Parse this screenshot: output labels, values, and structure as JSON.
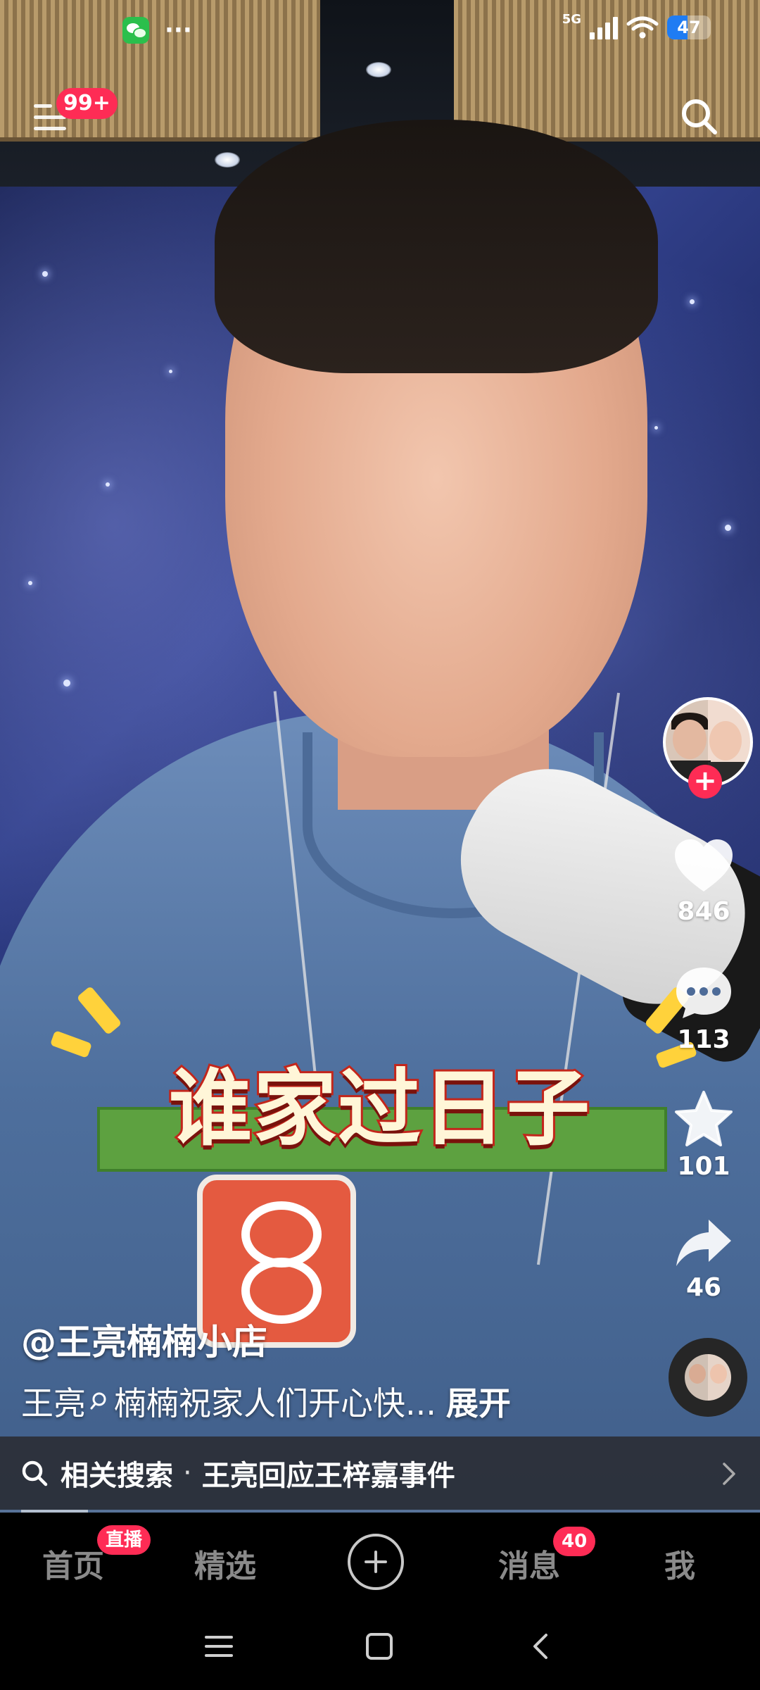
{
  "status_bar": {
    "more": "···",
    "network": "5G",
    "battery": "47",
    "battery_level": 0.47
  },
  "top_bar": {
    "menu_badge": "99+"
  },
  "video": {
    "caption_sticker": "谁家过日子"
  },
  "actions": {
    "follow_symbol": "+",
    "like_count": "846",
    "comment_count": "113",
    "favorite_count": "101",
    "share_count": "46"
  },
  "post": {
    "author": "@王亮楠楠小店",
    "desc_tag": "王亮",
    "desc_text": "楠楠祝家人们开心快...",
    "expand": "展开"
  },
  "related_search": {
    "label": "相关搜索",
    "separator": "·",
    "query": "王亮回应王梓嘉事件"
  },
  "tabs": [
    {
      "label": "首页",
      "badge": "直播"
    },
    {
      "label": "精选"
    },
    {
      "label": "消息",
      "badge": "40"
    },
    {
      "label": "我"
    }
  ],
  "colors": {
    "accent": "#fe2c55",
    "tab_inactive": "#8a8a8a"
  }
}
